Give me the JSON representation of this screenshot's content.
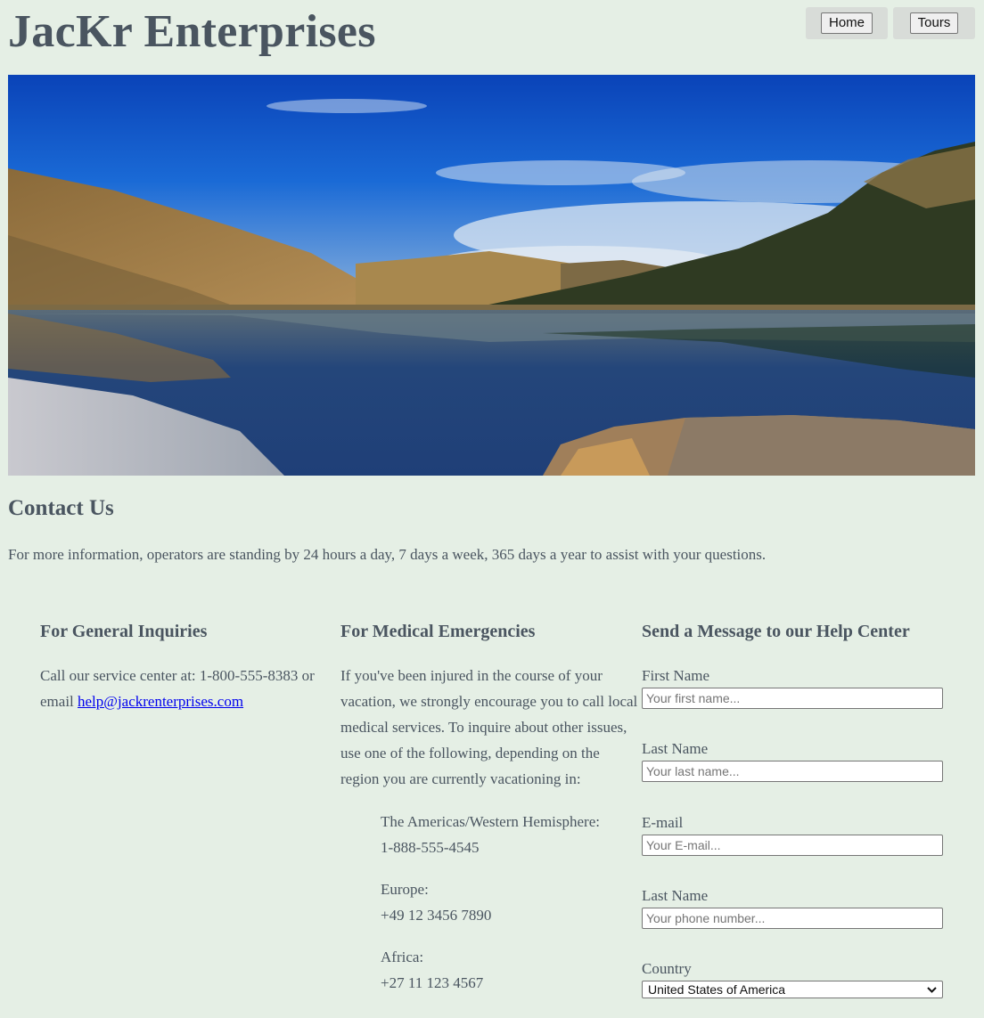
{
  "header": {
    "title": "JacKr Enterprises",
    "nav": [
      "Home",
      "Tours"
    ]
  },
  "contact": {
    "title": "Contact Us",
    "intro": "For more information, operators are standing by 24 hours a day, 7 days a week, 365 days a year to assist with your questions."
  },
  "general": {
    "title": "For General Inquiries",
    "text": "Call our service center at: 1-800-555-8383 or email ",
    "email": "help@jackrenterprises.com"
  },
  "medical": {
    "title": "For Medical Emergencies",
    "text": "If you've been injured in the course of your vacation, we strongly encourage you to call local medical services. To inquire about other issues, use one of the following, depending on the region you are currently vacationing in:",
    "regions": [
      {
        "name": "The Americas/Western Hemisphere:",
        "phone": "1-888-555-4545"
      },
      {
        "name": "Europe:",
        "phone": "+49 12 3456 7890"
      },
      {
        "name": "Africa:",
        "phone": "+27 11 123 4567"
      }
    ]
  },
  "form": {
    "title": "Send a Message to our Help Center",
    "fields": [
      {
        "label": "First Name",
        "placeholder": "Your first name...",
        "value": ""
      },
      {
        "label": "Last Name",
        "placeholder": "Your last name...",
        "value": ""
      },
      {
        "label": "E-mail",
        "placeholder": "Your E-mail...",
        "value": ""
      },
      {
        "label": "Last Name",
        "placeholder": "Your phone number...",
        "value": ""
      }
    ],
    "country": {
      "label": "Country",
      "selected": "United States of America"
    }
  },
  "icons": {
    "dropdown": "chevron-down-icon"
  },
  "colors": {
    "background": "#e5efe5",
    "text": "#4a5560",
    "link": "#0000ee"
  }
}
